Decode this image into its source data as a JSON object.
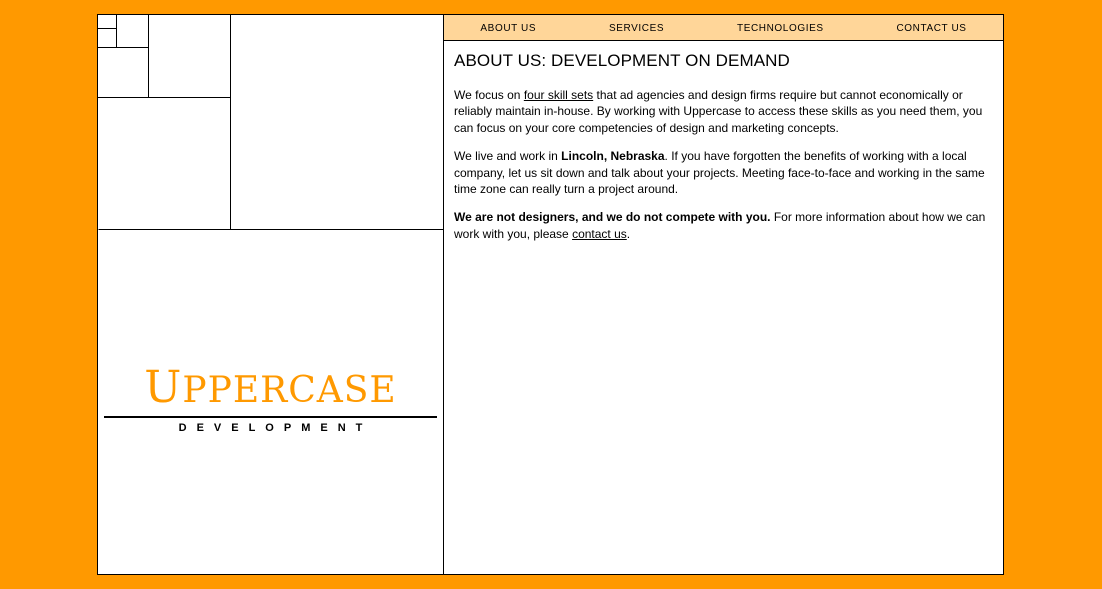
{
  "nav": {
    "items": [
      "ABOUT US",
      "SERVICES",
      "TECHNOLOGIES",
      "CONTACT US"
    ]
  },
  "logo": {
    "title_cap": "U",
    "title_rest": "PPERCASE",
    "subtitle": "DEVELOPMENT"
  },
  "content": {
    "title": "ABOUT US: DEVELOPMENT ON DEMAND",
    "p1": {
      "before": "We focus on ",
      "link": "four skill sets",
      "after": " that ad agencies and design firms require but cannot economically or reliably maintain in-house. By working with Uppercase to access these skills as you need them, you can focus on your core competencies of design and marketing concepts."
    },
    "p2": {
      "before": "We live and work in ",
      "bold": "Lincoln, Nebraska",
      "after": ". If you have forgotten the benefits of working with a local company, let us sit down and talk about your projects. Meeting face-to-face and working in the same time zone can really turn a project around."
    },
    "p3": {
      "bold": "We are not designers, and we do not compete with you.",
      "mid": " For more information about how we can work with you, please ",
      "link": "contact us",
      "end": "."
    }
  },
  "colors": {
    "background": "#FF9900",
    "nav_bg": "#FFD699",
    "logo": "#FF9900"
  }
}
